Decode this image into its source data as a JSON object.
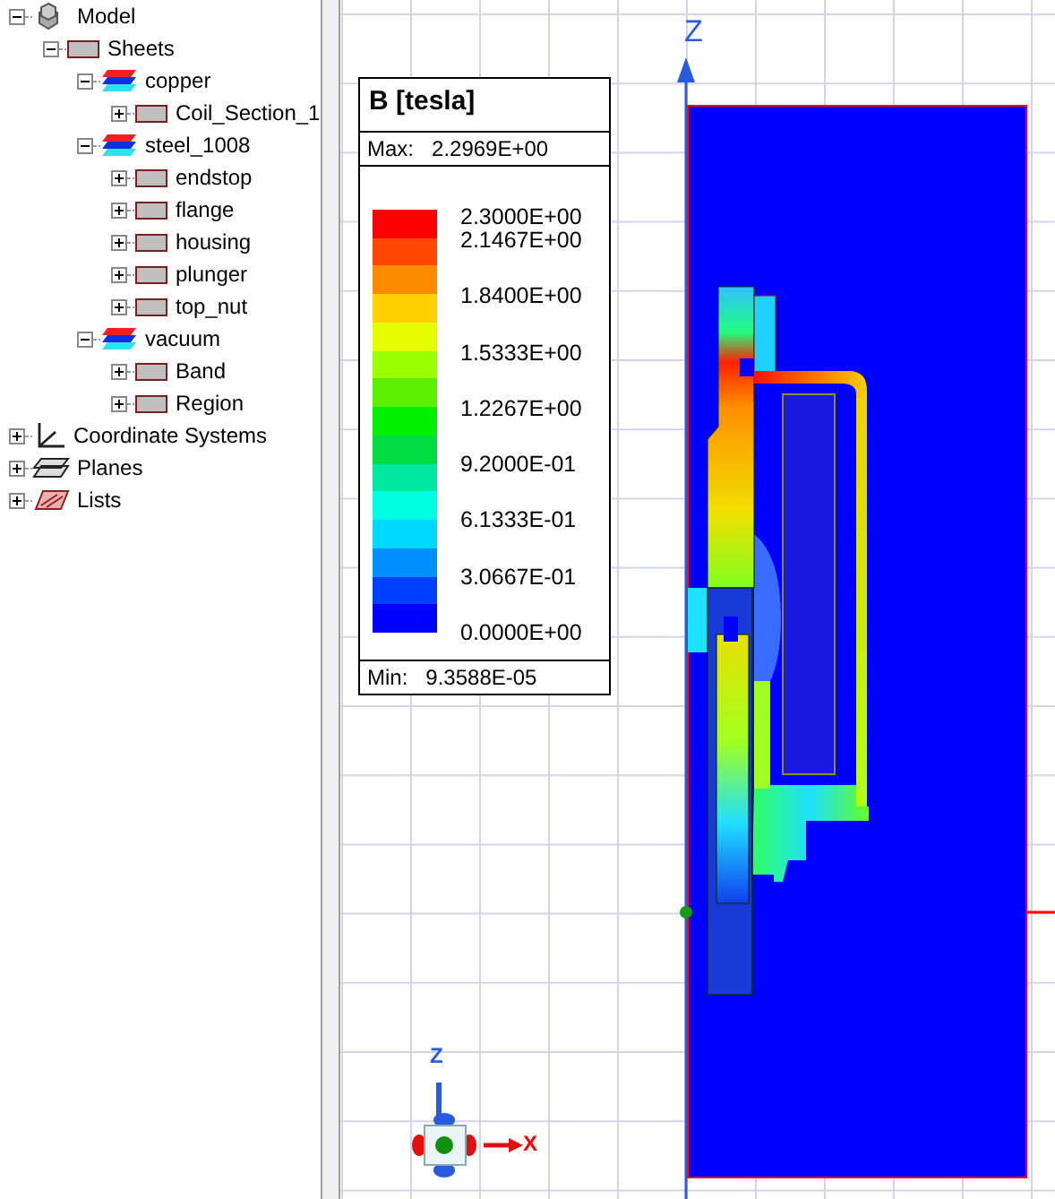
{
  "tree": [
    {
      "label": "Model",
      "kind": "model",
      "expanded": true,
      "children": [
        {
          "label": "Sheets",
          "kind": "folder",
          "expanded": true,
          "children": [
            {
              "label": "copper",
              "kind": "material",
              "expanded": true,
              "children": [
                {
                  "label": "Coil_Section_1",
                  "kind": "object",
                  "expanded": false
                }
              ]
            },
            {
              "label": "steel_1008",
              "kind": "material",
              "expanded": true,
              "children": [
                {
                  "label": "endstop",
                  "kind": "object",
                  "expanded": false
                },
                {
                  "label": "flange",
                  "kind": "object",
                  "expanded": false
                },
                {
                  "label": "housing",
                  "kind": "object",
                  "expanded": false
                },
                {
                  "label": "plunger",
                  "kind": "object",
                  "expanded": false
                },
                {
                  "label": "top_nut",
                  "kind": "object",
                  "expanded": false
                }
              ]
            },
            {
              "label": "vacuum",
              "kind": "material",
              "expanded": true,
              "children": [
                {
                  "label": "Band",
                  "kind": "object",
                  "expanded": false
                },
                {
                  "label": "Region",
                  "kind": "object",
                  "expanded": false
                }
              ]
            }
          ]
        }
      ]
    },
    {
      "label": "Coordinate Systems",
      "kind": "coordinates",
      "expanded": false
    },
    {
      "label": "Planes",
      "kind": "planes",
      "expanded": false
    },
    {
      "label": "Lists",
      "kind": "lists",
      "expanded": false
    }
  ],
  "viewport": {
    "z_axis_label": "Z",
    "triad": {
      "z_label": "Z",
      "x_label": "X"
    }
  },
  "legend": {
    "title": "B [tesla]",
    "max_label": "Max:",
    "max_value": "2.2969E+00",
    "min_label": "Min:",
    "min_value": "9.3588E-05",
    "bands": [
      {
        "color": "#ff0000"
      },
      {
        "color": "#ff4800"
      },
      {
        "color": "#ff8c00"
      },
      {
        "color": "#ffd000"
      },
      {
        "color": "#e6ff00"
      },
      {
        "color": "#9cff00"
      },
      {
        "color": "#5cf000"
      },
      {
        "color": "#00f000"
      },
      {
        "color": "#00dc40"
      },
      {
        "color": "#00e8a0"
      },
      {
        "color": "#00ffe0"
      },
      {
        "color": "#00d8ff"
      },
      {
        "color": "#0090ff"
      },
      {
        "color": "#0040ff"
      },
      {
        "color": "#0000ff"
      }
    ],
    "labels": [
      "2.3000E+00",
      "2.1467E+00",
      "1.8400E+00",
      "1.5333E+00",
      "1.2267E+00",
      "9.2000E-01",
      "6.1333E-01",
      "3.0667E-01",
      "0.0000E+00"
    ]
  }
}
